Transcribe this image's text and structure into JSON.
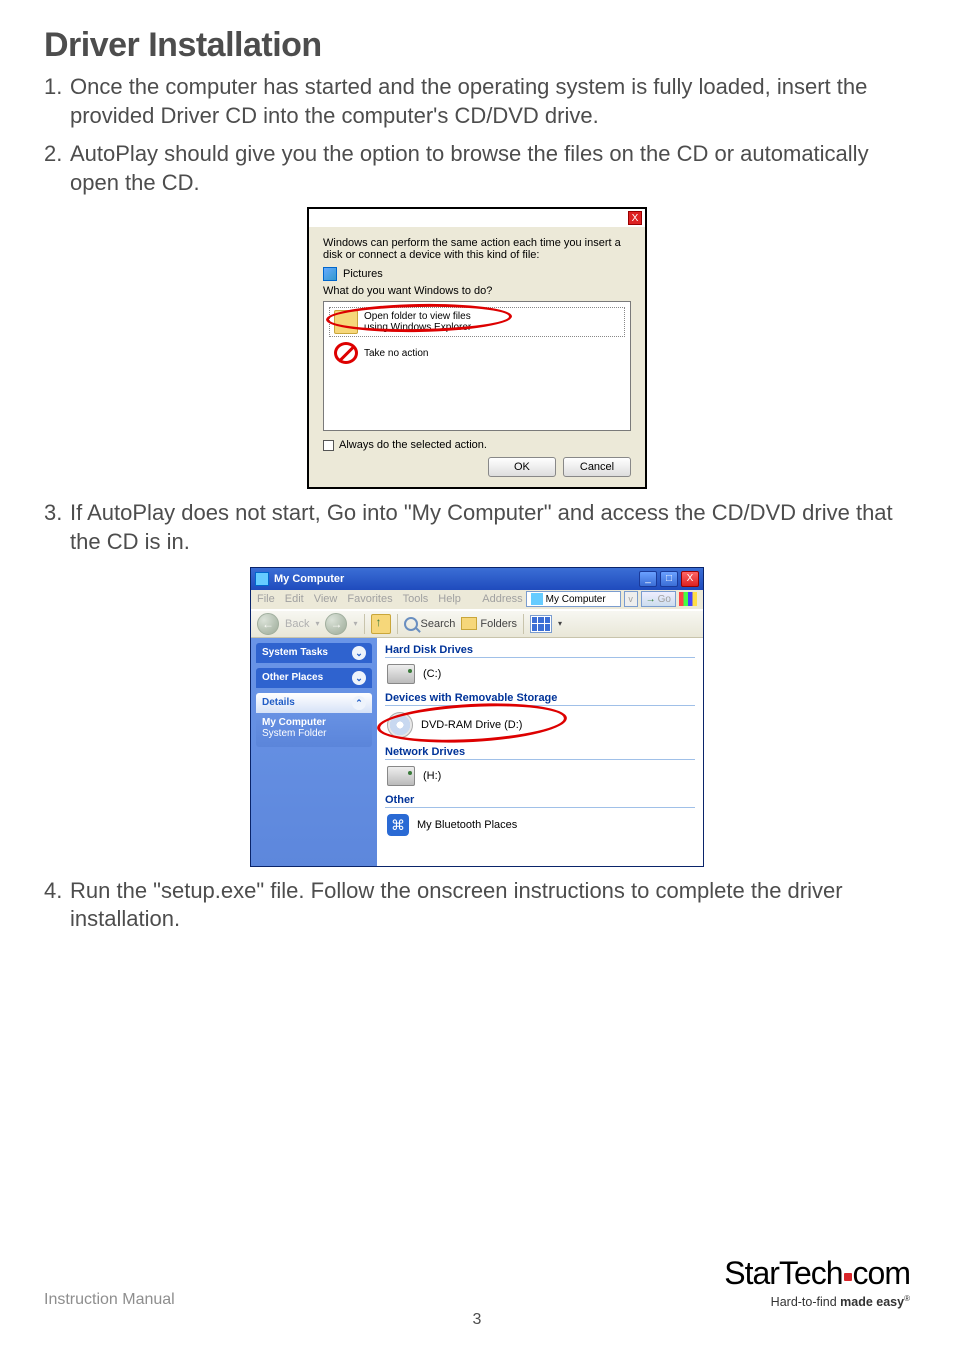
{
  "page": {
    "title": "Driver Installation",
    "footer_label": "Instruction Manual",
    "page_number": "3"
  },
  "steps": {
    "s1": {
      "n": "1.",
      "text": "Once the computer has started and the operating system is fully loaded, insert the provided Driver CD into the computer's CD/DVD drive."
    },
    "s2": {
      "n": "2.",
      "text": "AutoPlay should give you the option to browse the files on the CD or automatically open the CD."
    },
    "s3": {
      "n": "3.",
      "text": "If AutoPlay does not start, Go into \"My Computer\" and access the CD/DVD drive that the CD is in."
    },
    "s4": {
      "n": "4.",
      "text": "Run the \"setup.exe\" file.  Follow the onscreen instructions to complete the driver installation."
    }
  },
  "autoplay": {
    "close": "X",
    "message": "Windows can perform the same action each time you insert a disk or connect a device with this kind of file:",
    "pictures": "Pictures",
    "prompt": "What do you want Windows to do?",
    "opt_open_l1": "Open folder to view files",
    "opt_open_l2": "using Windows Explorer",
    "opt_none": "Take no action",
    "always": "Always do the selected action.",
    "ok": "OK",
    "cancel": "Cancel"
  },
  "mycomputer": {
    "title": "My Computer",
    "min": "_",
    "max": "□",
    "close": "X",
    "menu": {
      "file": "File",
      "edit": "Edit",
      "view": "View",
      "favorites": "Favorites",
      "tools": "Tools",
      "help": "Help"
    },
    "address_label": "Address",
    "address_value": "My Computer",
    "go": "Go",
    "back": "Back",
    "search": "Search",
    "folders": "Folders",
    "sidebar": {
      "tasks": "System Tasks",
      "places": "Other Places",
      "details": "Details",
      "details_l1": "My Computer",
      "details_l2": "System Folder"
    },
    "sections": {
      "hdd": "Hard Disk Drives",
      "removable": "Devices with Removable Storage",
      "network": "Network Drives",
      "other": "Other"
    },
    "items": {
      "c": "(C:)",
      "dvd": "DVD-RAM Drive (D:)",
      "h": "(H:)",
      "bt": "My Bluetooth Places"
    }
  },
  "brand": {
    "name_a": "StarTech",
    "name_b": "com",
    "tag_a": "Hard-to-find ",
    "tag_b": "made easy",
    "reg": "®"
  }
}
